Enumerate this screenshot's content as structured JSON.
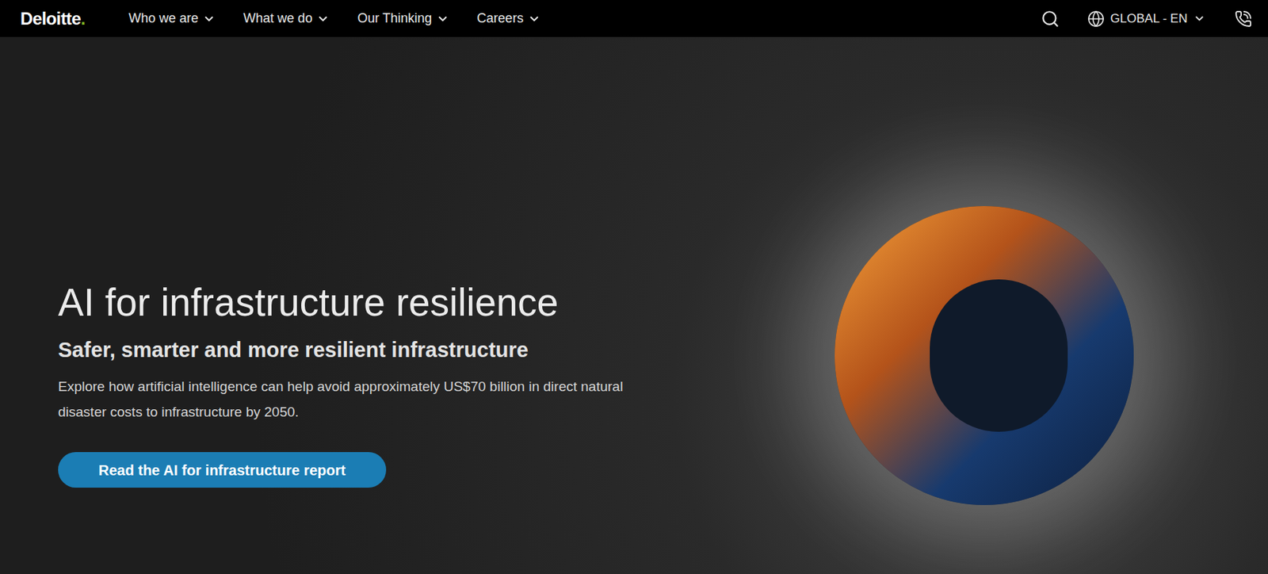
{
  "header": {
    "logo": {
      "text": "Deloitte",
      "dot": "."
    },
    "nav": [
      {
        "label": "Who we are"
      },
      {
        "label": "What we do"
      },
      {
        "label": "Our Thinking"
      },
      {
        "label": "Careers"
      }
    ],
    "locale": "GLOBAL - EN"
  },
  "hero": {
    "title": "AI for infrastructure resilience",
    "subtitle": "Safer, smarter and more resilient infrastructure",
    "body": "Explore how artificial intelligence can help avoid approximately US$70 billion in direct natural disaster costs to infrastructure by 2050.",
    "button": "Read the AI for infrastructure report"
  }
}
